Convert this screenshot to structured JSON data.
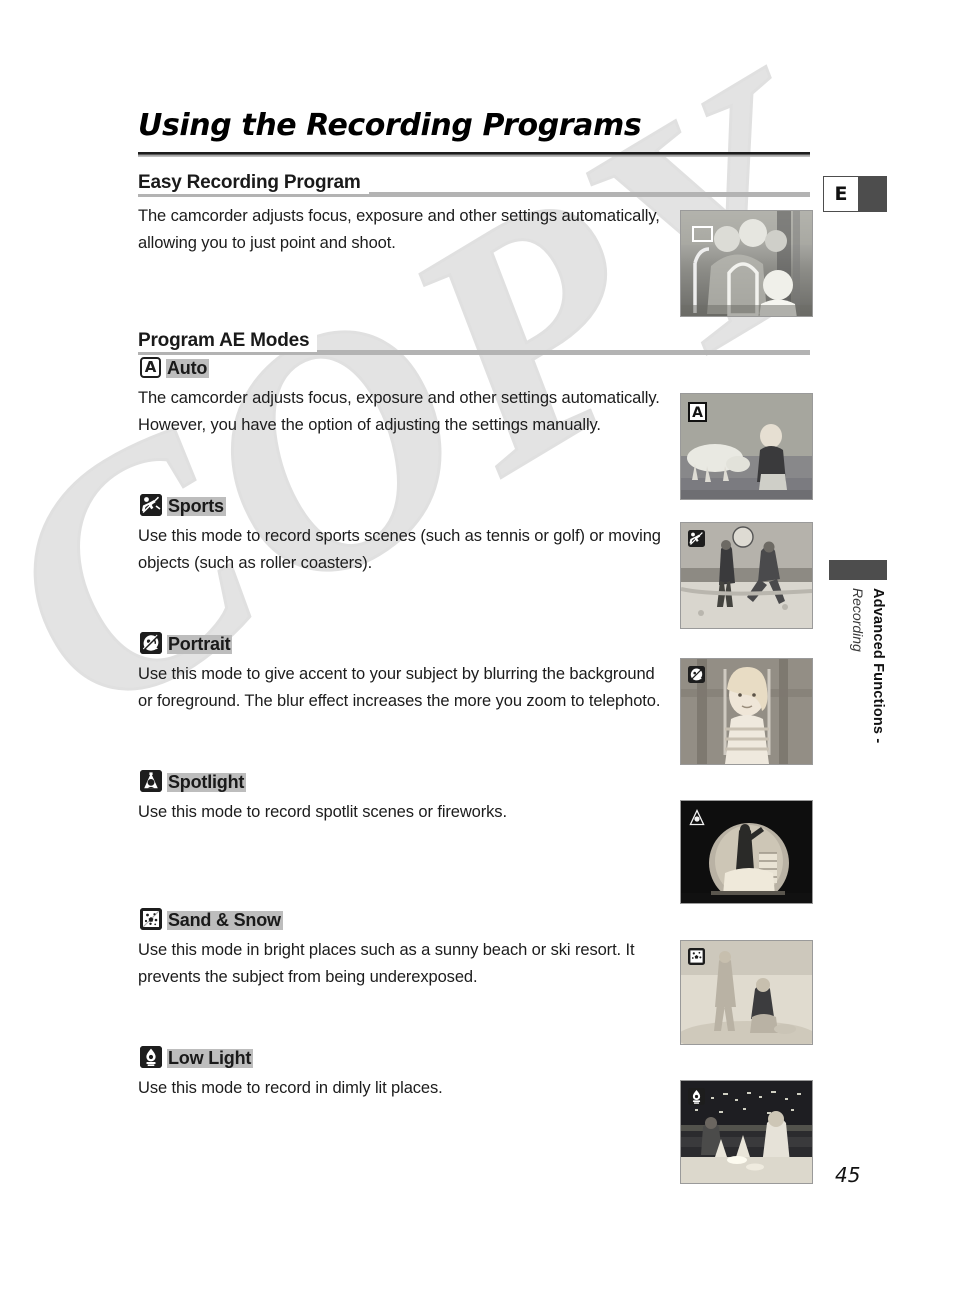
{
  "page": {
    "title": "Using the Recording Programs",
    "number": "45",
    "watermark": "COPY",
    "section_tab_letter": "E",
    "margin_text_line1": "Advanced Functions -",
    "margin_text_line2": "Recording"
  },
  "sections": [
    {
      "heading": "Easy Recording Program",
      "body": "The camcorder adjusts focus, exposure and other settings automatically, allowing you to just point and shoot.",
      "photo_alt": "children-on-playground-photo"
    },
    {
      "heading": "Program AE Modes"
    }
  ],
  "modes": [
    {
      "name": "Auto",
      "icon": "auto-a-icon",
      "body": "The camcorder adjusts focus, exposure and other settings automatically. However, you have the option of adjusting the settings manually.",
      "photo_alt": "dog-and-child-at-water-photo"
    },
    {
      "name": "Sports",
      "icon": "sports-runner-icon",
      "body": "Use this mode to record sports scenes (such as tennis or golf) or moving objects (such as roller coasters).",
      "photo_alt": "beach-volleyball-photo"
    },
    {
      "name": "Portrait",
      "icon": "portrait-head-icon",
      "body": "Use this mode to give accent to your subject by blurring the background or foreground. The blur effect increases the more you zoom to telephoto.",
      "photo_alt": "girl-on-swing-photo"
    },
    {
      "name": "Spotlight",
      "icon": "spotlight-cone-icon",
      "body": "Use this mode to record spotlit scenes or fireworks.",
      "photo_alt": "stage-performer-spotlit-photo"
    },
    {
      "name": "Sand & Snow",
      "icon": "sand-snow-icon",
      "body": "Use this mode in bright places such as a sunny beach or ski resort. It prevents the subject from being underexposed.",
      "photo_alt": "children-playing-in-sand-photo"
    },
    {
      "name": "Low Light",
      "icon": "low-light-candle-icon",
      "body": "Use this mode to record in dimly lit places.",
      "photo_alt": "couple-at-night-restaurant-photo"
    }
  ],
  "colors": {
    "rule_dark": "#1d1d1d",
    "rule_grey": "#b3b3b3",
    "highlight": "#bdbdbd",
    "tab_grey": "#4d4d4d",
    "watermark": "#e3e3e3"
  }
}
